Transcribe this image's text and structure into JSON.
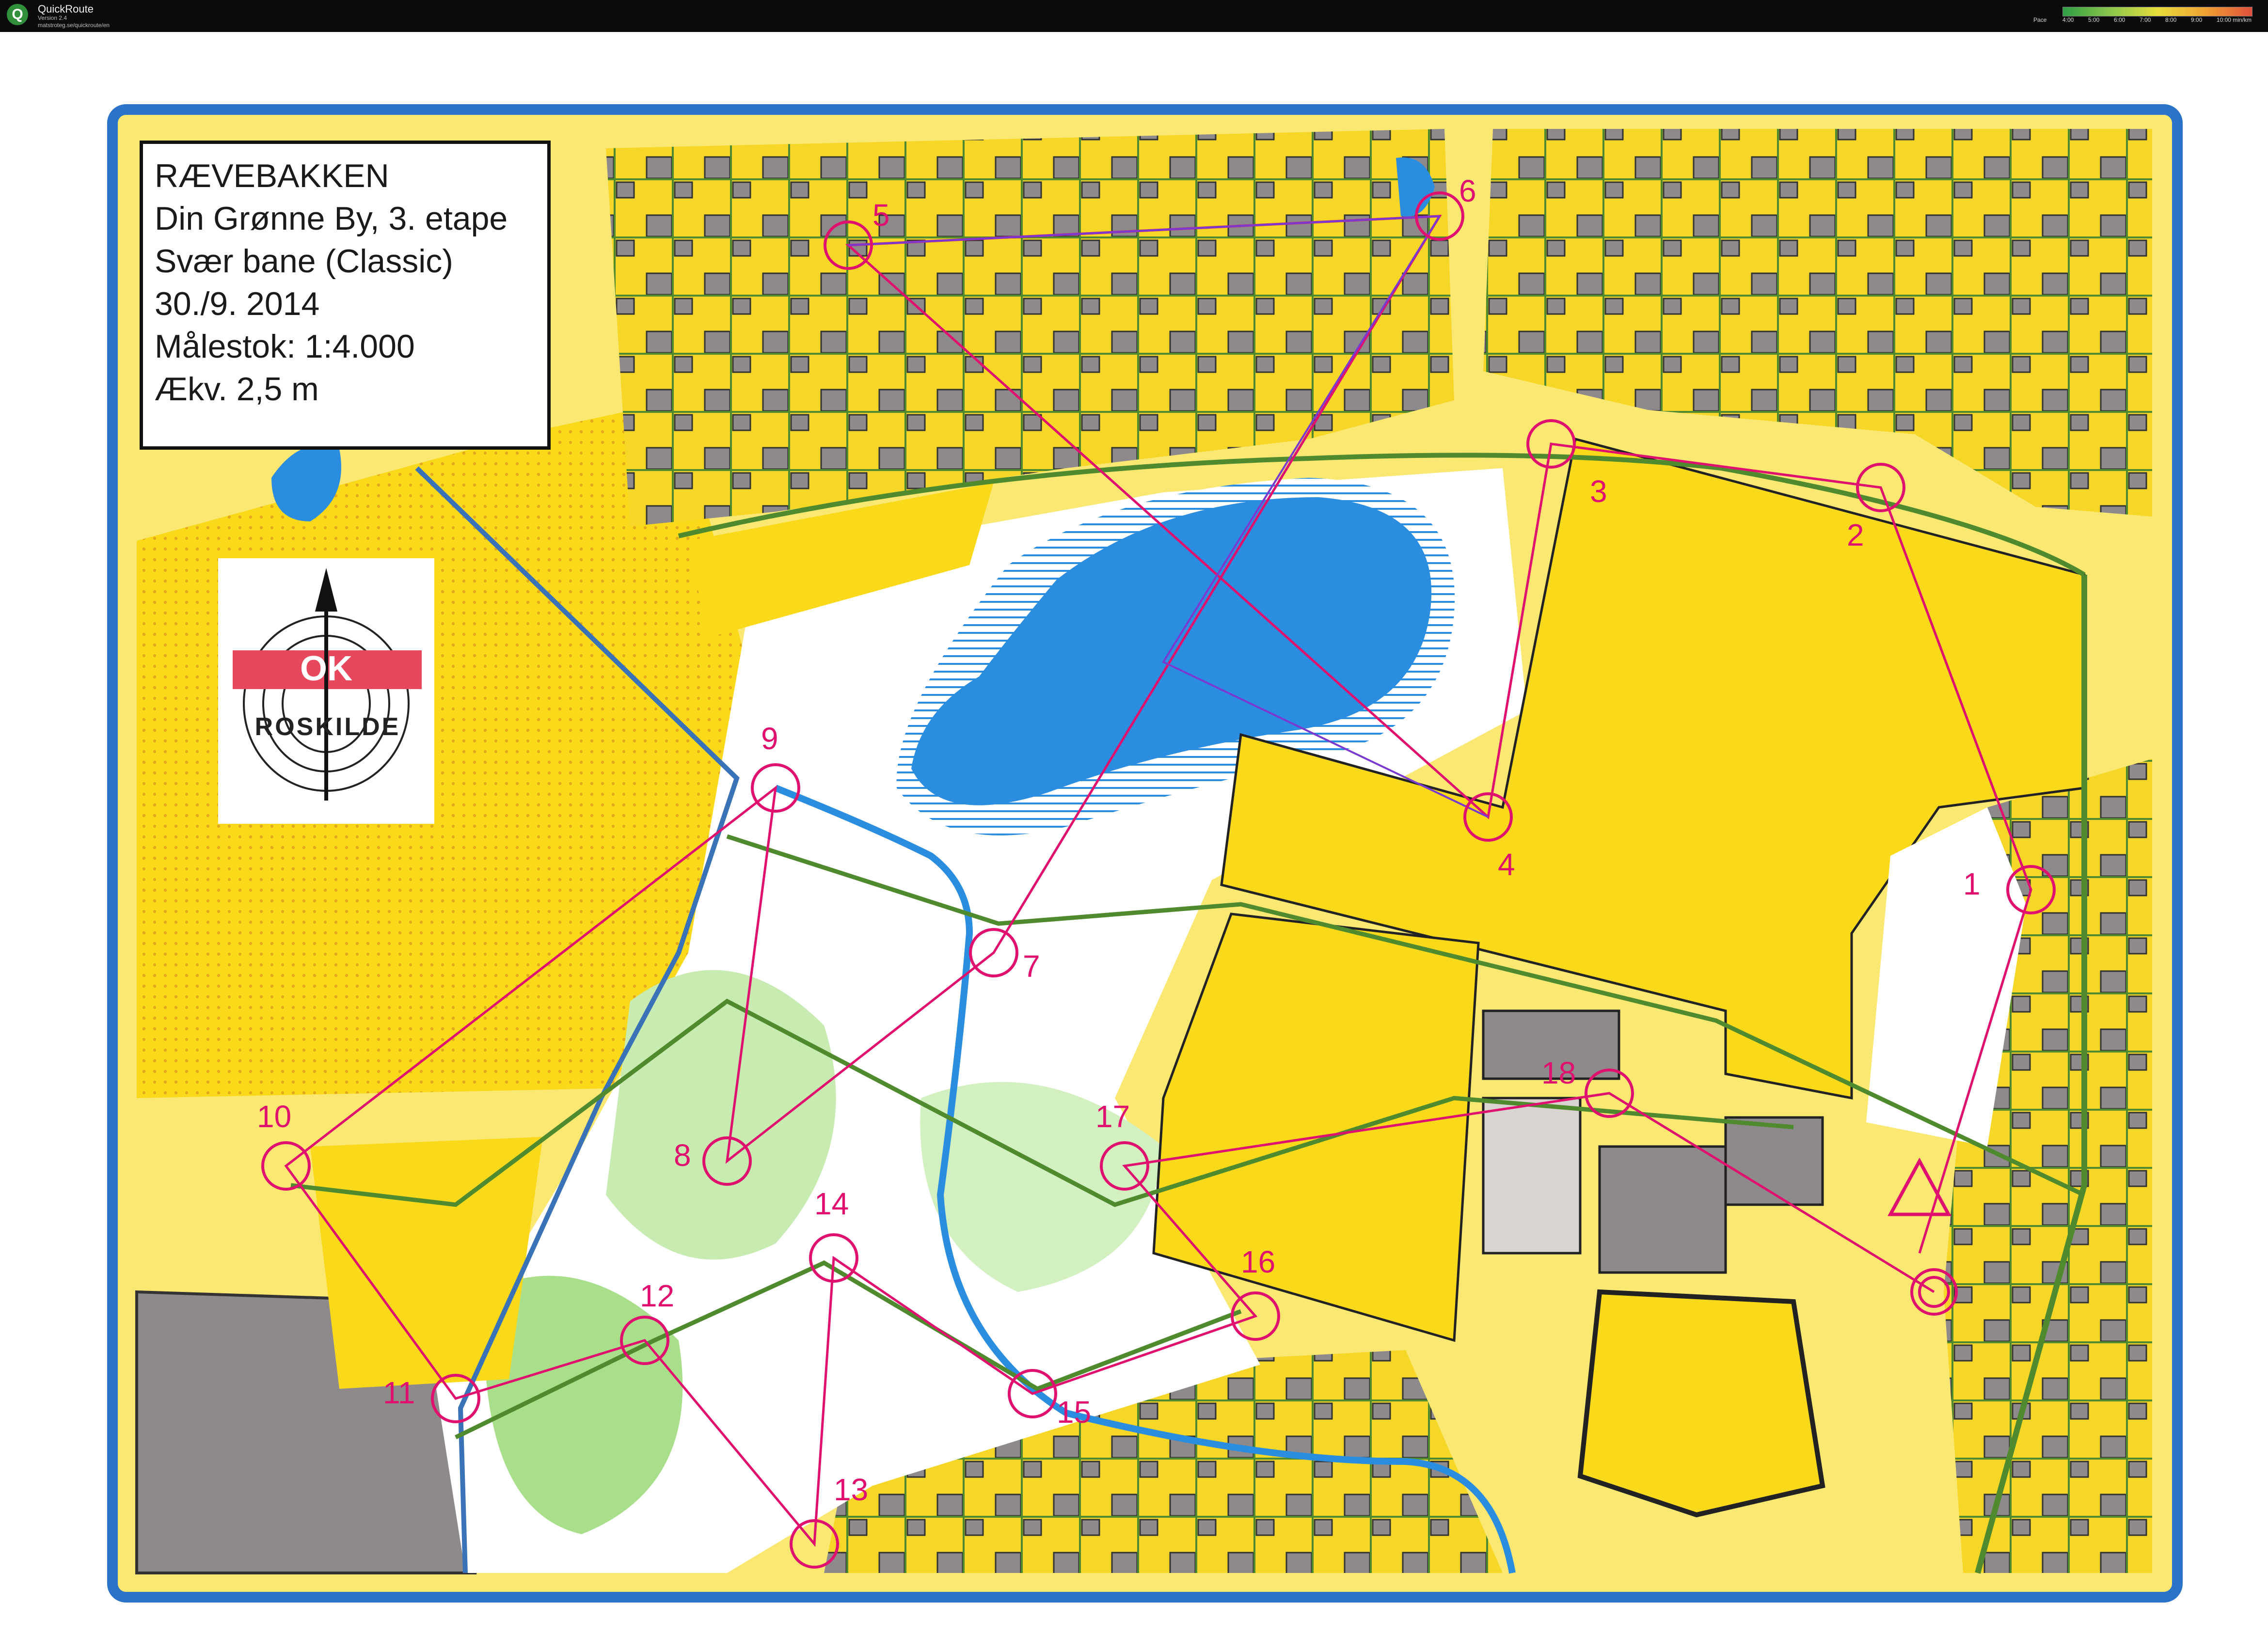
{
  "app": {
    "title": "QuickRoute",
    "version": "Version 2.4",
    "url": "matstroteg.se/quickroute/en",
    "icon": "Q"
  },
  "pace_legend": {
    "label": "Pace",
    "ticks": [
      "4:00",
      "5:00",
      "6:00",
      "7:00",
      "8:00",
      "9:00",
      "10:00 min/km"
    ]
  },
  "map": {
    "title_lines": [
      "RÆVEBAKKEN",
      "Din Grønne By, 3. etape",
      "Svær bane (Classic)",
      "30./9. 2014",
      "Målestok: 1:4.000",
      "Ækv. 2,5 m"
    ],
    "logo": {
      "text": "ROSKILDE",
      "mark": "OK",
      "icon": "north-arrow-icon"
    },
    "colors": {
      "open_yellow": "#f9d91a",
      "rough_open": "#fbe873",
      "forest_white": "#ffffff",
      "forest_green": "#8ed36b",
      "water_blue": "#2a8de0",
      "course_magenta": "#e0106f",
      "route_green": "#4f8a2e",
      "building_gray": "#8e8a8b",
      "frame_blue": "#2b73c9"
    },
    "controls": [
      {
        "label": "1"
      },
      {
        "label": "2"
      },
      {
        "label": "3"
      },
      {
        "label": "4"
      },
      {
        "label": "5"
      },
      {
        "label": "6"
      },
      {
        "label": "7"
      },
      {
        "label": "8"
      },
      {
        "label": "9"
      },
      {
        "label": "10"
      },
      {
        "label": "11"
      },
      {
        "label": "12"
      },
      {
        "label": "13"
      },
      {
        "label": "14"
      },
      {
        "label": "15"
      },
      {
        "label": "16"
      },
      {
        "label": "17"
      },
      {
        "label": "18"
      }
    ],
    "course_sequence": [
      "start",
      "1",
      "2",
      "3",
      "4",
      "5",
      "6",
      "7",
      "8",
      "9",
      "10",
      "11",
      "12",
      "13",
      "14",
      "15",
      "16",
      "17",
      "18",
      "finish"
    ]
  }
}
